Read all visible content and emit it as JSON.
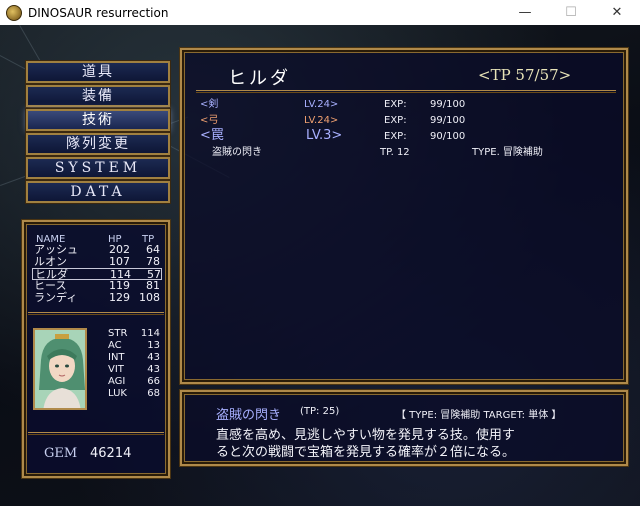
{
  "window": {
    "title": "DINOSAUR resurrection",
    "minimize": "—",
    "maximize": "☐",
    "close": "✕"
  },
  "menu": {
    "items": [
      "道具",
      "装備",
      "技術",
      "隊列変更",
      "SYSTEM",
      "DATA"
    ],
    "selected_index": 2
  },
  "party": {
    "headers": {
      "name": "NAME",
      "hp": "HP",
      "tp": "TP"
    },
    "members": [
      {
        "name": "アッシュ",
        "hp": "202",
        "tp": "64"
      },
      {
        "name": "ルオン",
        "hp": "107",
        "tp": "78"
      },
      {
        "name": "ヒルダ",
        "hp": "114",
        "tp": "57"
      },
      {
        "name": "ヒース",
        "hp": "119",
        "tp": "81"
      },
      {
        "name": "ランディ",
        "hp": "129",
        "tp": "108"
      }
    ],
    "selected_index": 2
  },
  "stats": [
    {
      "label": "STR",
      "value": "114"
    },
    {
      "label": "AC",
      "value": "13"
    },
    {
      "label": "INT",
      "value": "43"
    },
    {
      "label": "VIT",
      "value": "43"
    },
    {
      "label": "AGI",
      "value": "66"
    },
    {
      "label": "LUK",
      "value": "68"
    }
  ],
  "gem": {
    "label": "GEM",
    "value": "46214"
  },
  "character": {
    "name": "ヒルダ",
    "tp": "<TP 57/57>"
  },
  "skills": [
    {
      "category": "<剣",
      "level": "LV.24>",
      "exp_label": "EXP:",
      "exp": "99/100"
    },
    {
      "category": "<弓",
      "level": "LV.24>",
      "exp_label": "EXP:",
      "exp": "99/100"
    },
    {
      "category": "<罠",
      "level": "LV.3>",
      "exp_label": "EXP:",
      "exp": "90/100"
    }
  ],
  "skill_entry": {
    "name": "盗賊の閃き",
    "tp": "TP. 12",
    "type": "TYPE. 冒険補助"
  },
  "description": {
    "title": "盗賊の閃き",
    "tp": "(TP: 25)",
    "type_info": "【 TYPE: 冒険補助 TARGET: 単体 】",
    "line1": "直感を高め、見逃しやすい物を発見する技。使用す",
    "line2": "ると次の戦闘で宝箱を発見する確率が２倍になる。"
  },
  "colors": {
    "gold_frame": "#b08a4a",
    "panel_bg": "#0a0c28",
    "skill_blue": "#a8b0ff",
    "skill_orange": "#f0a070"
  }
}
